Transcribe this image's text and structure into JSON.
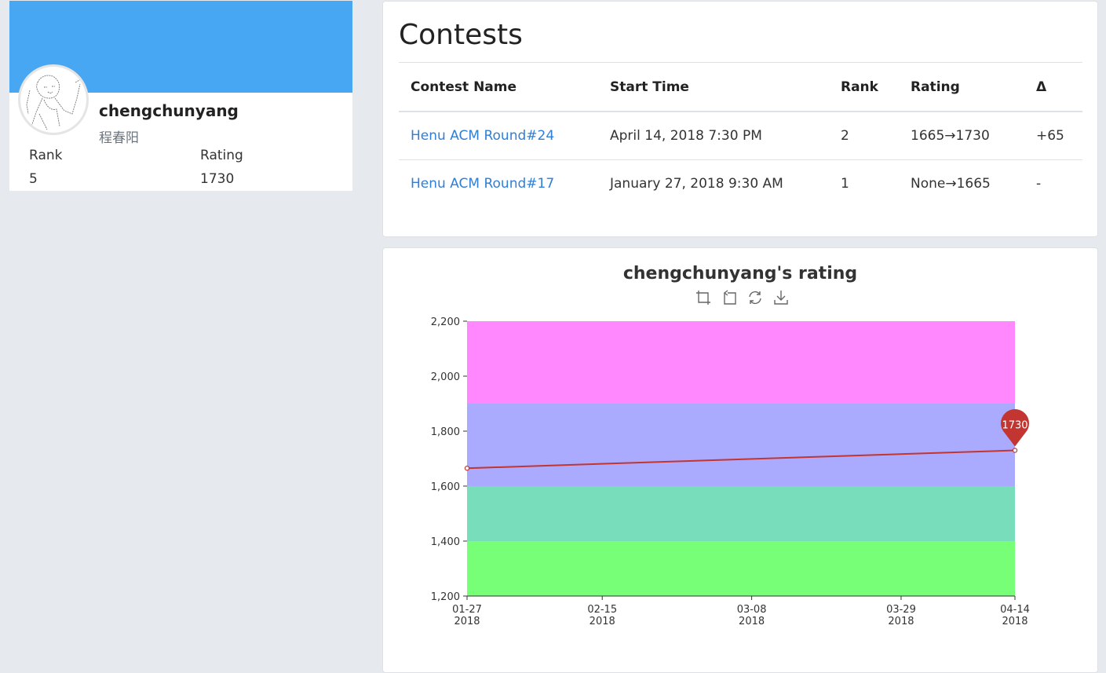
{
  "profile": {
    "username": "chengchunyang",
    "real_name": "程春阳",
    "rank_label": "Rank",
    "rating_label": "Rating",
    "rank_value": "5",
    "rating_value": "1730",
    "banner_color": "#48a7f3"
  },
  "contests": {
    "title": "Contests",
    "columns": [
      "Contest Name",
      "Start Time",
      "Rank",
      "Rating",
      "Δ"
    ],
    "rows": [
      {
        "name": "Henu ACM Round#24",
        "start": "April 14, 2018 7:30 PM",
        "rank": "2",
        "rating": "1665→1730",
        "delta": "+65"
      },
      {
        "name": "Henu ACM Round#17",
        "start": "January 27, 2018 9:30 AM",
        "rank": "1",
        "rating": "None→1665",
        "delta": "-"
      }
    ],
    "link_color": "#2f7fd6",
    "positive_delta_color": "#2e8b2e"
  },
  "chart": {
    "title": "chengchunyang's rating",
    "toolbox_icons": [
      "zoom-icon",
      "zoom-reset-icon",
      "restore-icon",
      "save-image-icon"
    ]
  },
  "chart_data": {
    "type": "line",
    "title": "chengchunyang's rating",
    "xlabel": "",
    "ylabel": "",
    "ylim": [
      1200,
      2200
    ],
    "y_ticks": [
      "1,200",
      "1,400",
      "1,600",
      "1,800",
      "2,000",
      "2,200"
    ],
    "x_ticks": [
      {
        "date": "2018-01-27",
        "line1": "01-27",
        "line2": "2018"
      },
      {
        "date": "2018-02-15",
        "line1": "02-15",
        "line2": "2018"
      },
      {
        "date": "2018-03-08",
        "line1": "03-08",
        "line2": "2018"
      },
      {
        "date": "2018-03-29",
        "line1": "03-29",
        "line2": "2018"
      },
      {
        "date": "2018-04-14",
        "line1": "04-14",
        "line2": "2018"
      }
    ],
    "xlim": [
      "2018-01-27",
      "2018-04-14"
    ],
    "series": [
      {
        "points": [
          {
            "x": "2018-01-27",
            "y": 1665
          },
          {
            "x": "2018-04-14",
            "y": 1730
          }
        ],
        "color": "#c23531"
      }
    ],
    "bands": [
      {
        "from": 1200,
        "to": 1400,
        "color": "#77ff77"
      },
      {
        "from": 1400,
        "to": 1600,
        "color": "#77ddbb"
      },
      {
        "from": 1600,
        "to": 1900,
        "color": "#aaaaff"
      },
      {
        "from": 1900,
        "to": 2200,
        "color": "#ff88ff"
      }
    ],
    "max_marker": {
      "x": "2018-04-14",
      "label": "1730",
      "color": "#c23531"
    },
    "grid": false
  }
}
